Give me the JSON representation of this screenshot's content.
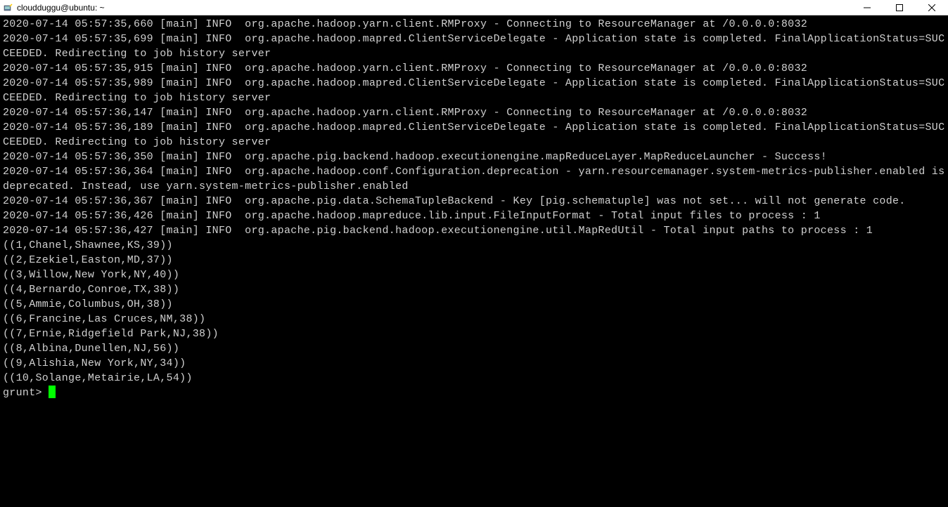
{
  "window": {
    "title": "cloudduggu@ubuntu: ~",
    "icon": "putty-icon"
  },
  "log_lines": [
    "2020-07-14 05:57:35,660 [main] INFO  org.apache.hadoop.yarn.client.RMProxy - Connecting to ResourceManager at /0.0.0.0:8032",
    "2020-07-14 05:57:35,699 [main] INFO  org.apache.hadoop.mapred.ClientServiceDelegate - Application state is completed. FinalApplicationStatus=SUCCEEDED. Redirecting to job history server",
    "2020-07-14 05:57:35,915 [main] INFO  org.apache.hadoop.yarn.client.RMProxy - Connecting to ResourceManager at /0.0.0.0:8032",
    "2020-07-14 05:57:35,989 [main] INFO  org.apache.hadoop.mapred.ClientServiceDelegate - Application state is completed. FinalApplicationStatus=SUCCEEDED. Redirecting to job history server",
    "2020-07-14 05:57:36,147 [main] INFO  org.apache.hadoop.yarn.client.RMProxy - Connecting to ResourceManager at /0.0.0.0:8032",
    "2020-07-14 05:57:36,189 [main] INFO  org.apache.hadoop.mapred.ClientServiceDelegate - Application state is completed. FinalApplicationStatus=SUCCEEDED. Redirecting to job history server",
    "2020-07-14 05:57:36,350 [main] INFO  org.apache.pig.backend.hadoop.executionengine.mapReduceLayer.MapReduceLauncher - Success!",
    "2020-07-14 05:57:36,364 [main] INFO  org.apache.hadoop.conf.Configuration.deprecation - yarn.resourcemanager.system-metrics-publisher.enabled is deprecated. Instead, use yarn.system-metrics-publisher.enabled",
    "2020-07-14 05:57:36,367 [main] INFO  org.apache.pig.data.SchemaTupleBackend - Key [pig.schematuple] was not set... will not generate code.",
    "2020-07-14 05:57:36,426 [main] INFO  org.apache.hadoop.mapreduce.lib.input.FileInputFormat - Total input files to process : 1",
    "2020-07-14 05:57:36,427 [main] INFO  org.apache.pig.backend.hadoop.executionengine.util.MapRedUtil - Total input paths to process : 1",
    "((1,Chanel,Shawnee,KS,39))",
    "((2,Ezekiel,Easton,MD,37))",
    "((3,Willow,New York,NY,40))",
    "((4,Bernardo,Conroe,TX,38))",
    "((5,Ammie,Columbus,OH,38))",
    "((6,Francine,Las Cruces,NM,38))",
    "((7,Ernie,Ridgefield Park,NJ,38))",
    "((8,Albina,Dunellen,NJ,56))",
    "((9,Alishia,New York,NY,34))",
    "((10,Solange,Metairie,LA,54))"
  ],
  "prompt": "grunt> "
}
